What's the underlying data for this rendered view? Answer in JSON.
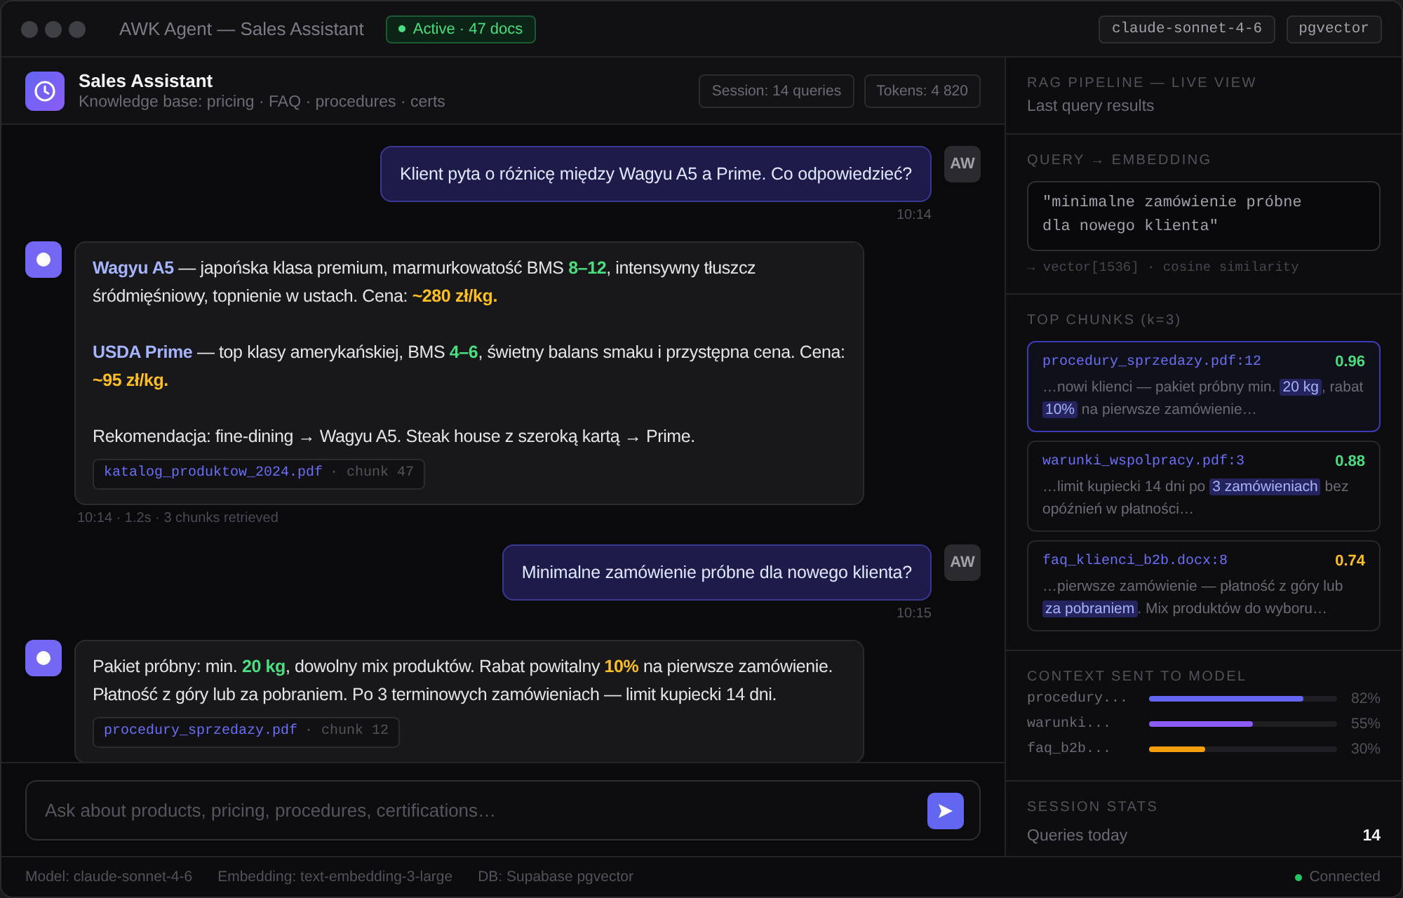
{
  "window": {
    "title": "AWK Agent — Sales Assistant",
    "status": {
      "label": "Active · 47 docs",
      "active": true
    },
    "tags": [
      "claude-sonnet-4-6",
      "pgvector"
    ]
  },
  "chat": {
    "header": {
      "title": "Sales Assistant",
      "subtitle": "Knowledge base: pricing · FAQ · procedures · certs",
      "stats": [
        "Session: 14 queries",
        "Tokens: 4 820"
      ]
    },
    "messages": [
      {
        "kind": "user",
        "avatar": "AW",
        "text": "Klient pyta o różnicę między Wagyu A5 a Prime. Co odpowiedzieć?",
        "time": "10:14"
      },
      {
        "kind": "assistant",
        "paragraphs": [
          [
            {
              "kind": "term",
              "text": "Wagyu A5"
            },
            {
              "kind": "plain",
              "text": " — japońska klasa premium, marmurkowatość BMS "
            },
            {
              "kind": "spec",
              "text": "8–12"
            },
            {
              "kind": "plain",
              "text": ", intensywny tłuszcz śródmięśniowy, topnienie w ustach. Cena: "
            },
            {
              "kind": "price",
              "text": "~280 zł/kg."
            }
          ],
          [
            {
              "kind": "term",
              "text": "USDA Prime"
            },
            {
              "kind": "plain",
              "text": " — top klasy amerykańskiej, BMS "
            },
            {
              "kind": "spec",
              "text": "4–6"
            },
            {
              "kind": "plain",
              "text": ", świetny balans smaku i przystępna cena. Cena: "
            },
            {
              "kind": "price",
              "text": "~95 zł/kg."
            }
          ],
          [
            {
              "kind": "plain",
              "text": "Rekomendacja: fine-dining → Wagyu A5. Steak house z szeroką kartą → Prime."
            }
          ]
        ],
        "source": {
          "file": "katalog_produktow_2024.pdf",
          "chunk": "· chunk 47"
        },
        "meta": "10:14 · 1.2s · 3 chunks retrieved"
      },
      {
        "kind": "user",
        "avatar": "AW",
        "text": "Minimalne zamówienie próbne dla nowego klienta?",
        "time": "10:15"
      },
      {
        "kind": "assistant",
        "paragraphs": [
          [
            {
              "kind": "plain",
              "text": "Pakiet próbny: min. "
            },
            {
              "kind": "spec",
              "text": "20 kg"
            },
            {
              "kind": "plain",
              "text": ", dowolny mix produktów. Rabat powitalny "
            },
            {
              "kind": "price",
              "text": "10%"
            },
            {
              "kind": "plain",
              "text": " na pierwsze zamówienie. Płatność z góry lub za pobraniem. Po 3 terminowych zamówieniach — limit kupiecki 14 dni."
            }
          ]
        ],
        "source": {
          "file": "procedury_sprzedazy.pdf",
          "chunk": "· chunk 12"
        }
      }
    ],
    "input": {
      "placeholder": "Ask about products, pricing, procedures, certifications…"
    }
  },
  "pipeline": {
    "title": "RAG PIPELINE — LIVE VIEW",
    "subtitle": "Last query results",
    "query": {
      "heading": "QUERY → EMBEDDING",
      "text": "\"minimalne zamówienie próbne dla nowego klienta\"",
      "vector": "→ vector[1536] · cosine similarity"
    },
    "chunks": {
      "heading": "TOP CHUNKS (k=3)",
      "items": [
        {
          "source": "procedury_sprzedazy.pdf:12",
          "score": "0.96",
          "color": "#4ade80",
          "selected": true,
          "snippet": [
            {
              "kind": "plain",
              "text": "…nowi klienci — pakiet próbny min. "
            },
            {
              "kind": "match",
              "text": "20 kg"
            },
            {
              "kind": "plain",
              "text": ", rabat "
            },
            {
              "kind": "match",
              "text": "10%"
            },
            {
              "kind": "plain",
              "text": " na pierwsze zamówienie…"
            }
          ]
        },
        {
          "source": "warunki_wspolpracy.pdf:3",
          "score": "0.88",
          "color": "#4ade80",
          "selected": false,
          "snippet": [
            {
              "kind": "plain",
              "text": "…limit kupiecki 14 dni po "
            },
            {
              "kind": "match",
              "text": "3 zamówieniach"
            },
            {
              "kind": "plain",
              "text": " bez opóźnień w płatności…"
            }
          ]
        },
        {
          "source": "faq_klienci_b2b.docx:8",
          "score": "0.74",
          "color": "#fbbf24",
          "selected": false,
          "snippet": [
            {
              "kind": "plain",
              "text": "…pierwsze zamówienie — płatność z góry lub "
            },
            {
              "kind": "match",
              "text": "za pobraniem"
            },
            {
              "kind": "plain",
              "text": ". Mix produktów do wyboru…"
            }
          ]
        }
      ]
    },
    "context": {
      "heading": "CONTEXT SENT TO MODEL",
      "rows": [
        {
          "label": "procedury...",
          "level": 0.82,
          "value": "82%",
          "color": "#6366f1"
        },
        {
          "label": "warunki...",
          "level": 0.55,
          "value": "55%",
          "color": "#8b5cf6"
        },
        {
          "label": "faq_b2b...",
          "level": 0.3,
          "value": "30%",
          "color": "#f59e0b"
        }
      ]
    },
    "stats": {
      "heading": "SESSION STATS",
      "rows": [
        {
          "label": "Queries today",
          "value": "14"
        }
      ]
    }
  },
  "status_bar": {
    "items": [
      "Model: claude-sonnet-4-6",
      "Embedding: text-embedding-3-large",
      "DB: Supabase pgvector"
    ],
    "connection": {
      "label": "Connected",
      "online": true
    }
  }
}
